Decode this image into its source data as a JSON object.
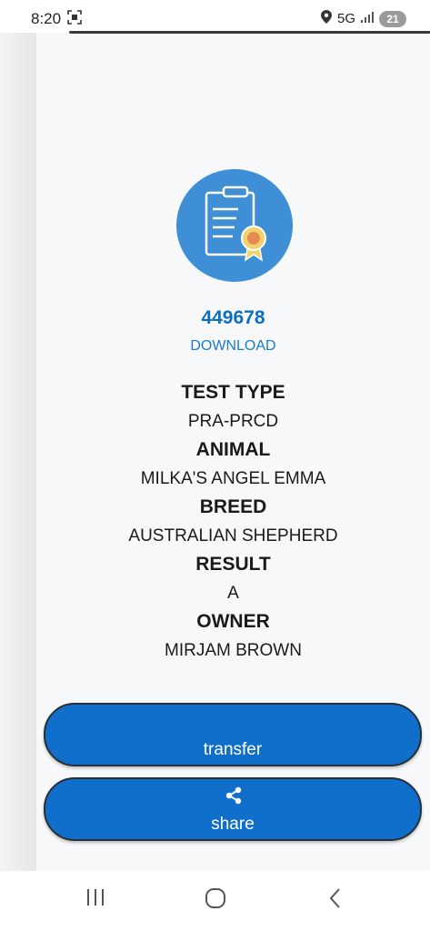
{
  "status_bar": {
    "time": "8:20",
    "network": "5G",
    "battery": "21"
  },
  "certificate": {
    "icon": "certificate-icon",
    "number": "449678",
    "download_label": "DOWNLOAD"
  },
  "details": [
    {
      "label": "TEST TYPE",
      "value": "PRA-PRCD"
    },
    {
      "label": "ANIMAL",
      "value": "MILKA'S ANGEL EMMA"
    },
    {
      "label": "BREED",
      "value": "AUSTRALIAN SHEPHERD"
    },
    {
      "label": "RESULT",
      "value": "A"
    },
    {
      "label": "OWNER",
      "value": "MIRJAM BROWN"
    }
  ],
  "actions": {
    "transfer_label": "transfer",
    "share_label": "share",
    "share_icon": "share-icon"
  },
  "colors": {
    "accent": "#0f6fcb",
    "number": "#0f6fbf",
    "icon_circle": "#3e8fd5",
    "background": "#f6f8fa"
  }
}
